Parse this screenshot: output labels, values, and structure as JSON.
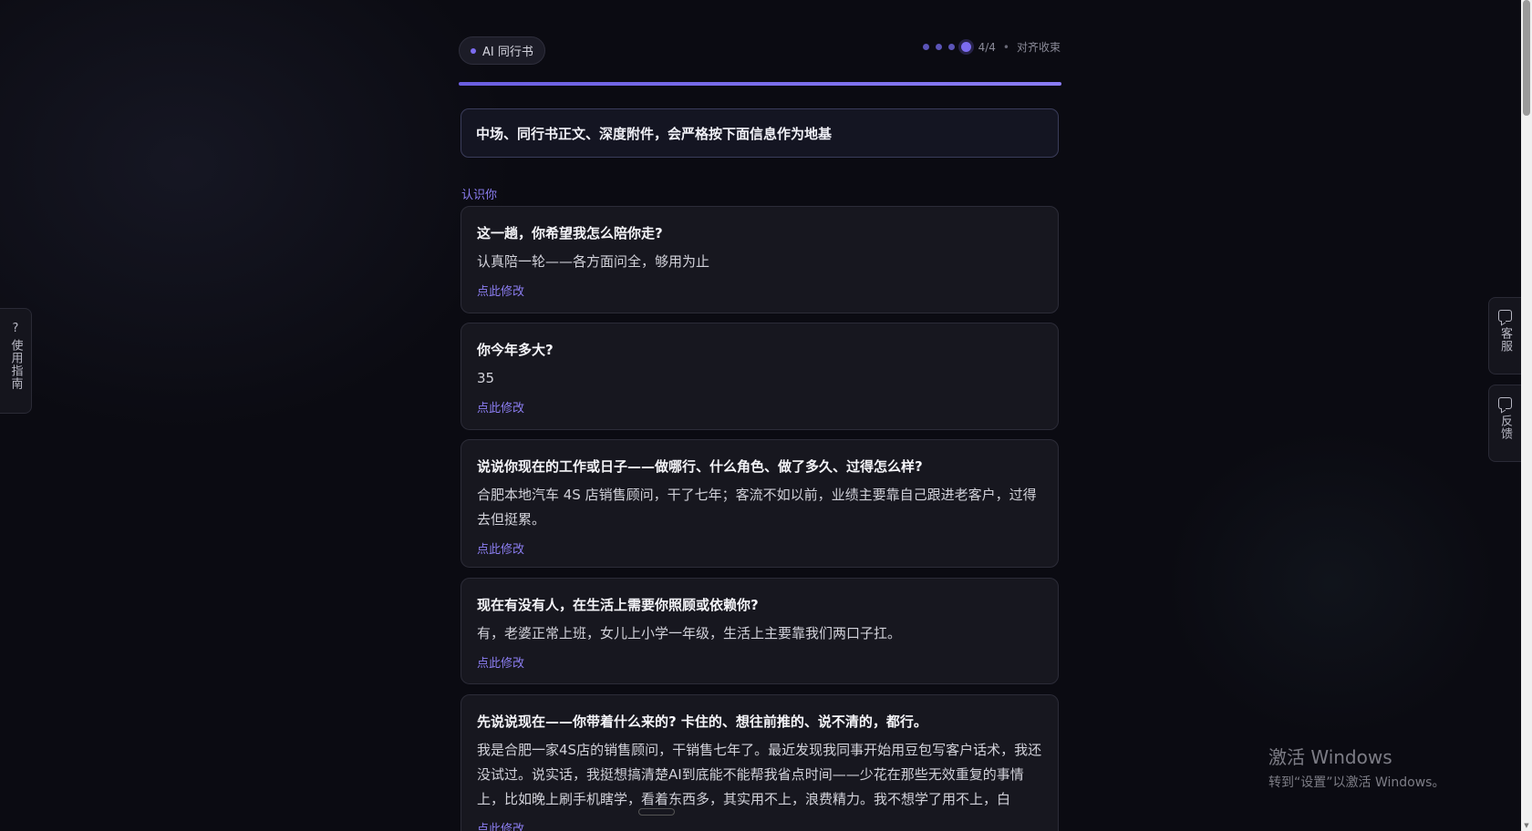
{
  "brand": {
    "label": "AI 同行书"
  },
  "steps": {
    "indicator": "4/4",
    "status": "对齐收束",
    "total": 4,
    "current": 4
  },
  "progress": {
    "percent": 100
  },
  "notice": {
    "text": "中场、同行书正文、深度附件，会严格按下面信息作为地基"
  },
  "section": {
    "label": "认识你"
  },
  "cards": [
    {
      "question": "这一趟，你希望我怎么陪你走?",
      "answer": "认真陪一轮——各方面问全，够用为止",
      "edit_label": "点此修改"
    },
    {
      "question": "你今年多大?",
      "answer": "35",
      "edit_label": "点此修改"
    },
    {
      "question": "说说你现在的工作或日子——做哪行、什么角色、做了多久、过得怎么样?",
      "answer": "合肥本地汽车 4S 店销售顾问，干了七年；客流不如以前，业绩主要靠自己跟进老客户，过得去但挺累。",
      "edit_label": "点此修改"
    },
    {
      "question": "现在有没有人，在生活上需要你照顾或依赖你?",
      "answer": "有，老婆正常上班，女儿上小学一年级，生活上主要靠我们两口子扛。",
      "edit_label": "点此修改"
    },
    {
      "question": "先说说现在——你带着什么来的? 卡住的、想往前推的、说不清的，都行。",
      "answer": "我是合肥一家4S店的销售顾问，干销售七年了。最近发现我同事开始用豆包写客户话术，我还没试过。说实话，我挺想搞清楚AI到底能不能帮我省点时间——少花在那些无效重复的事情上，比如晚上刷手机瞎学，看着东西多，其实用不上，浪费精力。我不想学了用不上，白",
      "edit_label": "点此修改"
    }
  ],
  "side_left": {
    "icon": "question-icon",
    "glyph": "?",
    "label": "使用指南"
  },
  "side_right": [
    {
      "icon": "chat-icon",
      "label": "客服"
    },
    {
      "icon": "chat-icon",
      "label": "反馈"
    }
  ],
  "watermark": {
    "line1": "激活 Windows",
    "line2": "转到“设置”以激活 Windows。"
  },
  "colors": {
    "accent": "#7c6cf0",
    "background": "#0b0b12",
    "card": "#17171f"
  }
}
